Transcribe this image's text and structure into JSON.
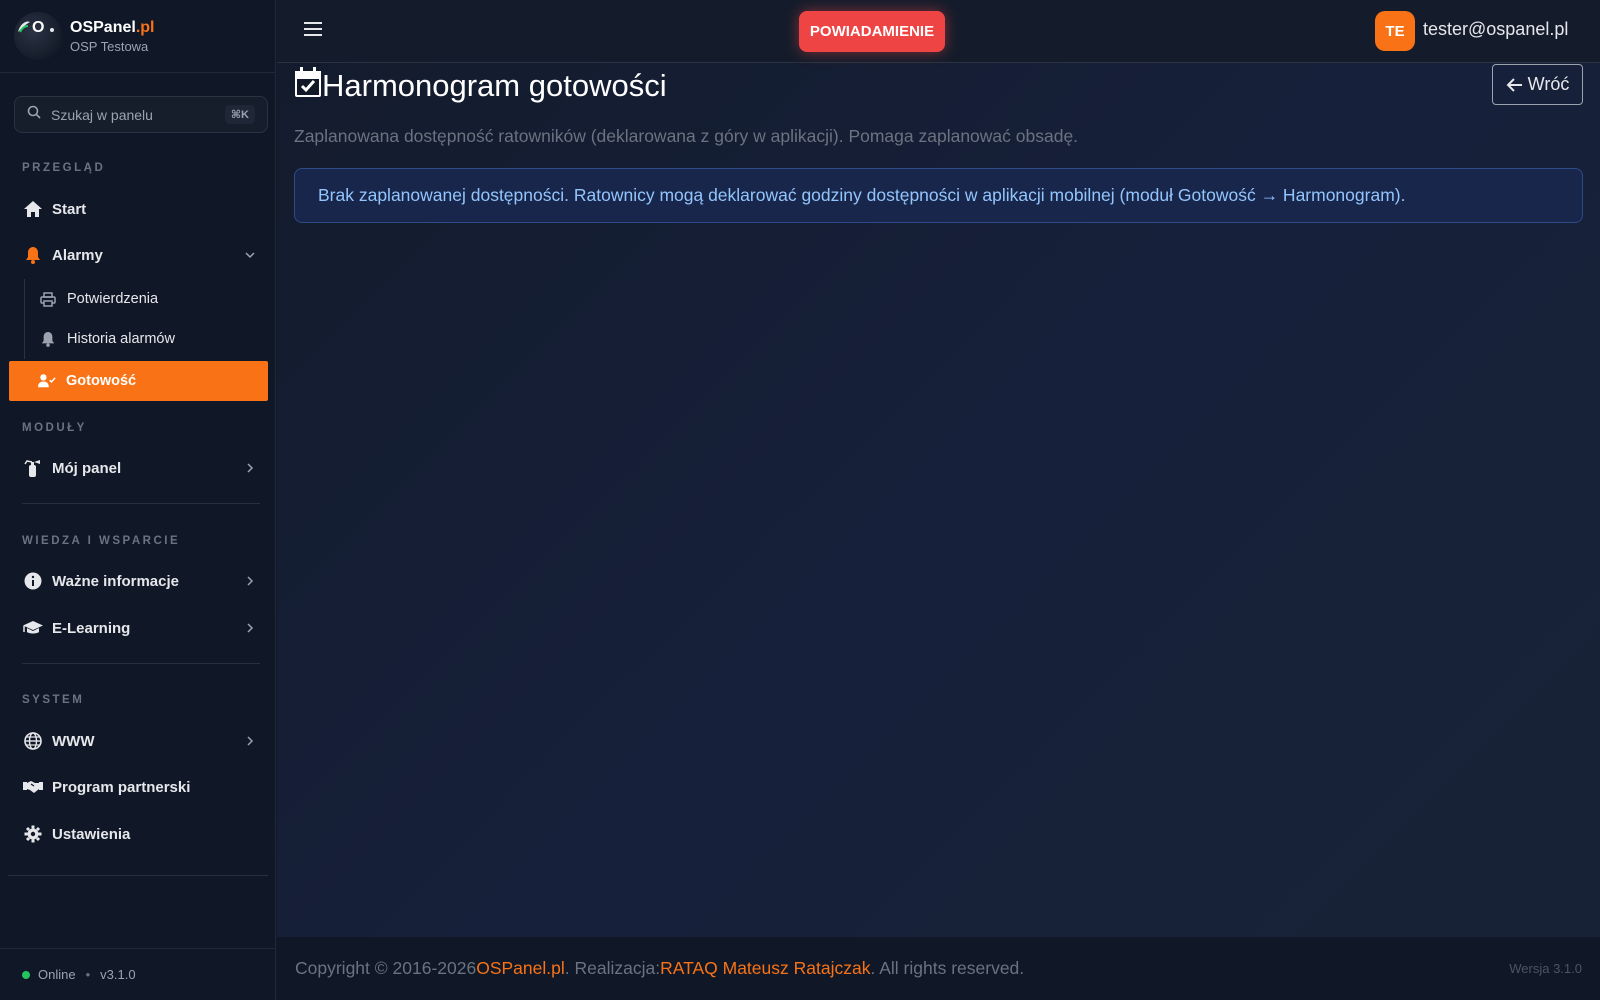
{
  "brand": {
    "name": "OSPanel",
    "tld": ".pl",
    "subtitle": "OSP Testowa"
  },
  "search": {
    "placeholder": "Szukaj w panelu",
    "shortcut": "⌘K"
  },
  "sidebar": {
    "sections": {
      "overview": "PRZEGLĄD",
      "modules": "MODUŁY",
      "knowledge": "WIEDZA I WSPARCIE",
      "system": "SYSTEM"
    },
    "items": {
      "start": "Start",
      "alarms": "Alarmy",
      "confirmations": "Potwierdzenia",
      "alarm_history": "Historia alarmów",
      "readiness": "Gotowość",
      "my_panel": "Mój panel",
      "important_info": "Ważne informacje",
      "elearning": "E-Learning",
      "www": "WWW",
      "partner_program": "Program partnerski",
      "settings": "Ustawienia"
    },
    "footer": {
      "status": "Online",
      "version": "v3.1.0"
    }
  },
  "topbar": {
    "notify_label": "POWIADAMIENIE",
    "avatar_initials": "TE",
    "user_email": "tester@ospanel.pl"
  },
  "page": {
    "title": "Harmonogram gotowości",
    "back_label": "Wróć",
    "description": "Zaplanowana dostępność ratowników (deklarowana z góry w aplikacji). Pomaga zaplanować obsadę.",
    "alert": "Brak zaplanowanej dostępności. Ratownicy mogą deklarować godziny dostępności w aplikacji mobilnej (moduł Gotowość → Harmonogram)."
  },
  "footer": {
    "copyright": "Copyright © 2016-2026 ",
    "brand_link": "OSPanel.pl",
    "realization": ". Realizacja: ",
    "author_link": "RATAQ Mateusz Ratajczak",
    "rights": ". All rights reserved.",
    "version": "Wersja 3.1.0"
  },
  "colors": {
    "accent": "#f97316",
    "danger": "#ef4444",
    "info": "#93c5fd",
    "online": "#22c55e"
  },
  "icons": {
    "start": "home-icon",
    "alarms": "bell-icon",
    "confirmations": "printer-icon",
    "alarm_history": "bell-icon",
    "readiness": "user-check-icon",
    "my_panel": "fire-extinguisher-icon",
    "important_info": "info-circle-icon",
    "elearning": "graduation-cap-icon",
    "www": "globe-icon",
    "partner_program": "handshake-icon",
    "settings": "gear-icon",
    "title": "calendar-check-icon"
  }
}
